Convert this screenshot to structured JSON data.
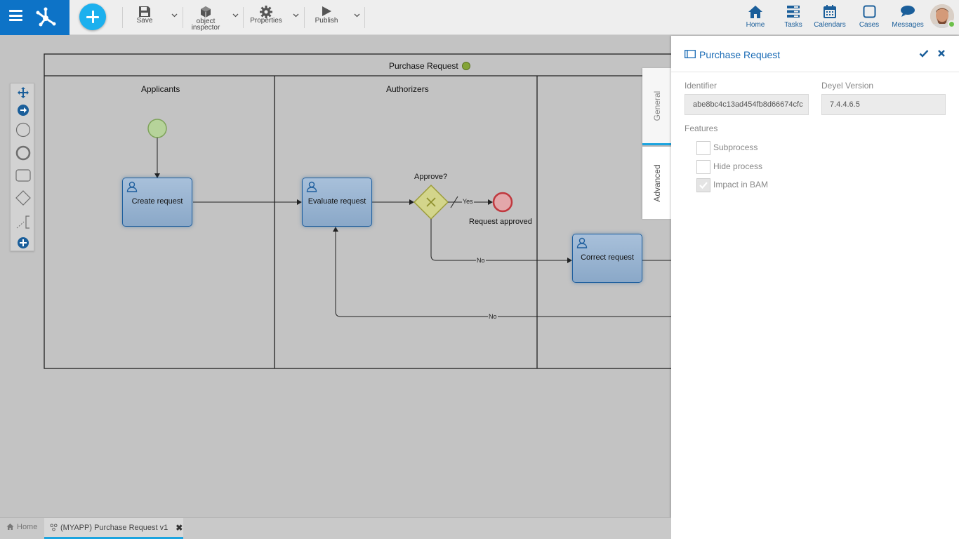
{
  "toolbar": {
    "save": "Save",
    "object_inspector_line1": "object",
    "object_inspector_line2": "inspector",
    "properties": "Properties",
    "publish": "Publish"
  },
  "nav": {
    "home": "Home",
    "tasks": "Tasks",
    "calendars": "Calendars",
    "cases": "Cases",
    "messages": "Messages"
  },
  "diagram": {
    "pool_title": "Purchase Request",
    "lanes": [
      "Applicants",
      "Authorizers"
    ],
    "tasks": {
      "create": "Create request",
      "evaluate": "Evaluate request",
      "correct": "Correct request"
    },
    "gateway_label": "Approve?",
    "end_label": "Request approved",
    "flow_yes": "Yes",
    "flow_no": "No"
  },
  "panel": {
    "title": "Purchase Request",
    "identifier_label": "Identifier",
    "identifier_value": "abe8bc4c13ad454fb8d66674cfc",
    "version_label": "Deyel Version",
    "version_value": "7.4.4.6.5",
    "features_label": "Features",
    "features": [
      {
        "label": "Subprocess",
        "checked": false
      },
      {
        "label": "Hide process",
        "checked": false
      },
      {
        "label": "Impact in BAM",
        "checked": true
      }
    ],
    "tabs": {
      "general": "General",
      "advanced": "Advanced"
    }
  },
  "bottom_tabs": {
    "home": "Home",
    "process": "(MYAPP) Purchase Request v1"
  },
  "colors": {
    "brand": "#0d73c7",
    "accent": "#1cb0ee",
    "link": "#1a6bb5"
  }
}
